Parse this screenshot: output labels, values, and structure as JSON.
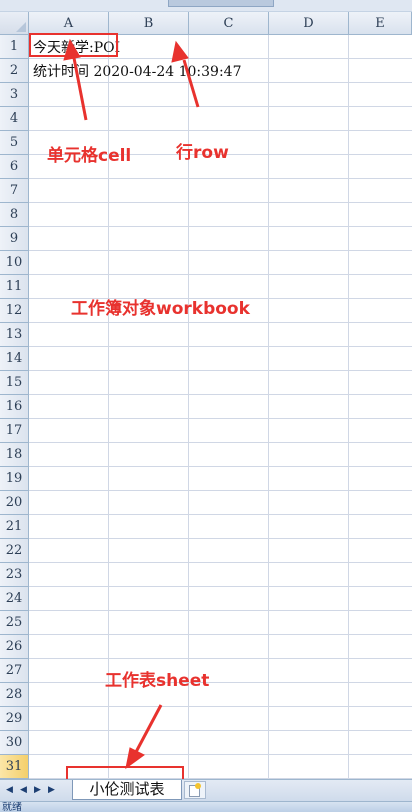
{
  "columns": [
    "A",
    "B",
    "C",
    "D",
    "E"
  ],
  "rows": [
    "1",
    "2",
    "3",
    "4",
    "5",
    "6",
    "7",
    "8",
    "9",
    "10",
    "11",
    "12",
    "13",
    "14",
    "15",
    "16",
    "17",
    "18",
    "19",
    "20",
    "21",
    "22",
    "23",
    "24",
    "25",
    "26",
    "27",
    "28",
    "29",
    "30",
    "31"
  ],
  "cells": {
    "a1": "今天新学:POI",
    "a2": "统计时间 2020-04-24 10:39:47"
  },
  "annotations": {
    "cell": "单元格cell",
    "row": "行row",
    "workbook": "工作簿对象workbook",
    "sheet": "工作表sheet"
  },
  "sheet_tab": {
    "label": "小伦测试表"
  },
  "nav_buttons": [
    "◀",
    "◀",
    "▶",
    "▶"
  ],
  "status": {
    "text": "就绪"
  },
  "colors": {
    "annotation_red": "#e8322e",
    "grid_line": "#d0d7e5",
    "header_bg": "#dde5f0",
    "active_row_header": "#f4cf6b"
  }
}
